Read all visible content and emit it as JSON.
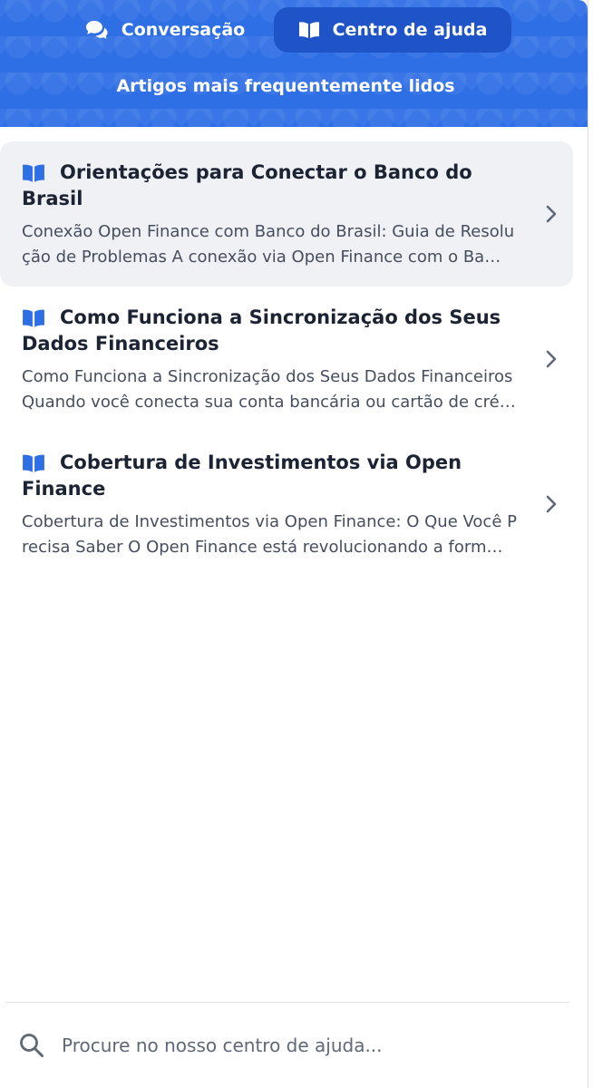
{
  "tabs": [
    {
      "label": "Conversação",
      "icon": "chat-bubbles-icon",
      "selected": false
    },
    {
      "label": "Centro de ajuda",
      "icon": "book-open-icon",
      "selected": true
    }
  ],
  "header": {
    "title": "Artigos mais frequentemente lidos",
    "color": "#2f6fe6"
  },
  "articles": [
    {
      "title": "Orientações para Conectar o Banco do Brasil",
      "excerpt": "Conexão Open Finance com Banco do Brasil: Guia de Resolução de Problemas A conexão via Open Finance com o Ba…",
      "icon": "book-open-icon"
    },
    {
      "title": "Como Funciona a Sincronização dos Seus Dados Financeiros",
      "excerpt": "Como Funciona a Sincronização dos Seus Dados Financeiros Quando você conecta sua conta bancária ou cartão de cré…",
      "icon": "book-open-icon"
    },
    {
      "title": "Cobertura de Investimentos via Open Finance",
      "excerpt": "Cobertura de Investimentos via Open Finance: O Que Você Precisa Saber O Open Finance está revolucionando a form…",
      "icon": "book-open-icon"
    }
  ],
  "search": {
    "placeholder": "Procure no nosso centro de ajuda...",
    "value": ""
  },
  "colors": {
    "accent": "#2f6fe6",
    "active_tab": "#1f54c9",
    "icon_blue": "#2f6fe6"
  }
}
